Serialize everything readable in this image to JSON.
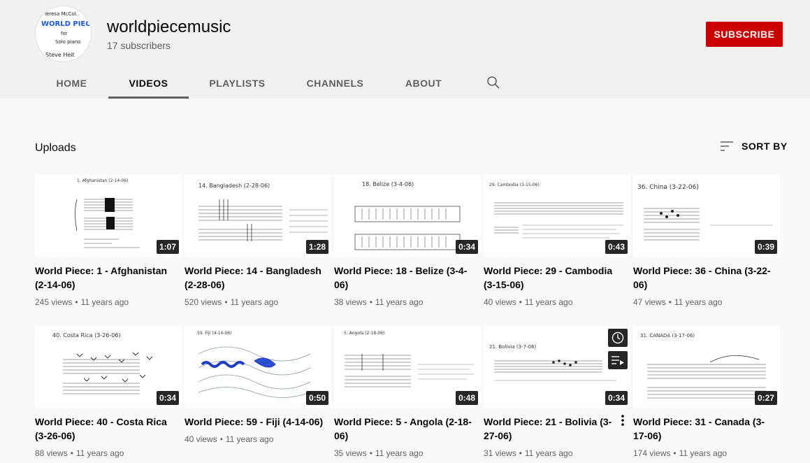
{
  "channel": {
    "name": "worldpiecemusic",
    "subscribers": "17 subscribers",
    "subscribe_label": "SUBSCRIBE",
    "avatar_text": [
      "Teresa McCol..",
      "WORLD PIEC",
      "for",
      "Solo piano",
      "Steve Heit"
    ]
  },
  "tabs": [
    {
      "label": "HOME"
    },
    {
      "label": "VIDEOS"
    },
    {
      "label": "PLAYLISTS"
    },
    {
      "label": "CHANNELS"
    },
    {
      "label": "ABOUT"
    }
  ],
  "section": {
    "title": "Uploads",
    "sort_label": "SORT BY"
  },
  "videos": [
    {
      "title": "World Piece: 1 - Afghanistan (2-14-06)",
      "views": "245 views",
      "age": "11 years ago",
      "duration": "1:07",
      "thumb_caption": "1. Afghanistan (2-14-06)"
    },
    {
      "title": "World Piece: 14 - Bangladesh (2-28-06)",
      "views": "520 views",
      "age": "11 years ago",
      "duration": "1:28",
      "thumb_caption": "14. Bangladesh (2-28-06)"
    },
    {
      "title": "World Piece: 18 - Belize (3-4-06)",
      "views": "38 views",
      "age": "11 years ago",
      "duration": "0:34",
      "thumb_caption": "18. Belize (3-4-06)"
    },
    {
      "title": "World Piece: 29 - Cambodia (3-15-06)",
      "views": "40 views",
      "age": "11 years ago",
      "duration": "0:43",
      "thumb_caption": "29. Cambodia (3-15-06)"
    },
    {
      "title": "World Piece: 36 - China (3-22-06)",
      "views": "47 views",
      "age": "11 years ago",
      "duration": "0:39",
      "thumb_caption": "36. China (3-22-06)"
    },
    {
      "title": "World Piece: 40 - Costa Rica (3-26-06)",
      "views": "88 views",
      "age": "11 years ago",
      "duration": "0:34",
      "thumb_caption": "40. Costa Rica (3-26-06)"
    },
    {
      "title": "World Piece: 59 - Fiji (4-14-06)",
      "views": "40 views",
      "age": "11 years ago",
      "duration": "0:50",
      "thumb_caption": "59. Fiji (4-14-06)"
    },
    {
      "title": "World Piece: 5 - Angola (2-18-06)",
      "views": "35 views",
      "age": "11 years ago",
      "duration": "0:48",
      "thumb_caption": "5. Angola (2-18-06)"
    },
    {
      "title": "World Piece: 21 - Bolivia (3-27-06)",
      "views": "31 views",
      "age": "11 years ago",
      "duration": "0:34",
      "thumb_caption": "21. Bolivia (3-7-06)"
    },
    {
      "title": "World Piece: 31 - Canada (3-17-06)",
      "views": "174 views",
      "age": "11 years ago",
      "duration": "0:27",
      "thumb_caption": "31. CANADA (3-17-06)"
    }
  ],
  "meta_separator": "•",
  "colors": {
    "subscribe": "#cc0000",
    "header_bg": "#f1f1f1",
    "page_bg": "#f9f9f9",
    "secondary_text": "#606060"
  },
  "icons": {
    "search": "search-icon",
    "sort": "sort-icon",
    "watch_later": "clock-icon",
    "add_to_queue": "queue-icon",
    "more": "more-vert-icon"
  }
}
